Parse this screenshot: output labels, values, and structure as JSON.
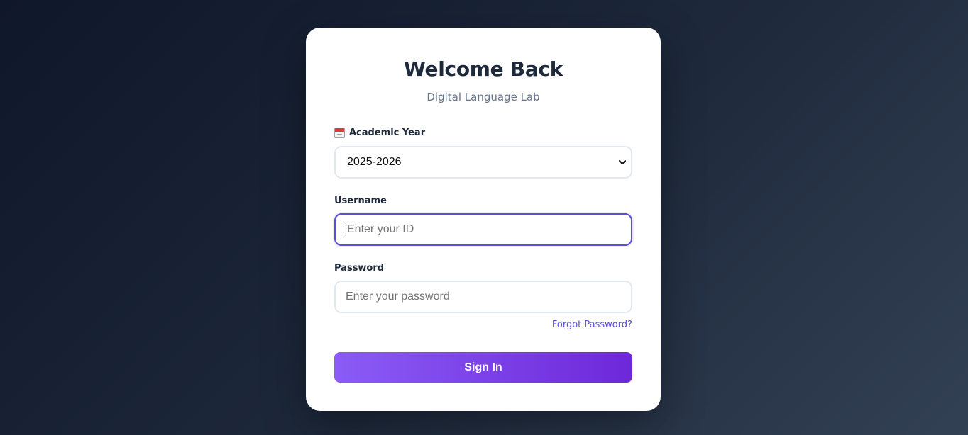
{
  "card": {
    "title": "Welcome Back",
    "subtitle": "Digital Language Lab"
  },
  "academic_year": {
    "label": "Academic Year",
    "icon": "calendar-icon",
    "selected": "2025-2026"
  },
  "username": {
    "label": "Username",
    "placeholder": "Enter your ID",
    "value": ""
  },
  "password": {
    "label": "Password",
    "placeholder": "Enter your password",
    "value": ""
  },
  "forgot_password": "Forgot Password?",
  "sign_in": "Sign In",
  "colors": {
    "accent": "#5b4fd6",
    "button_start": "#8b5cf6",
    "button_end": "#6d28d9",
    "background": "#0f172a"
  }
}
